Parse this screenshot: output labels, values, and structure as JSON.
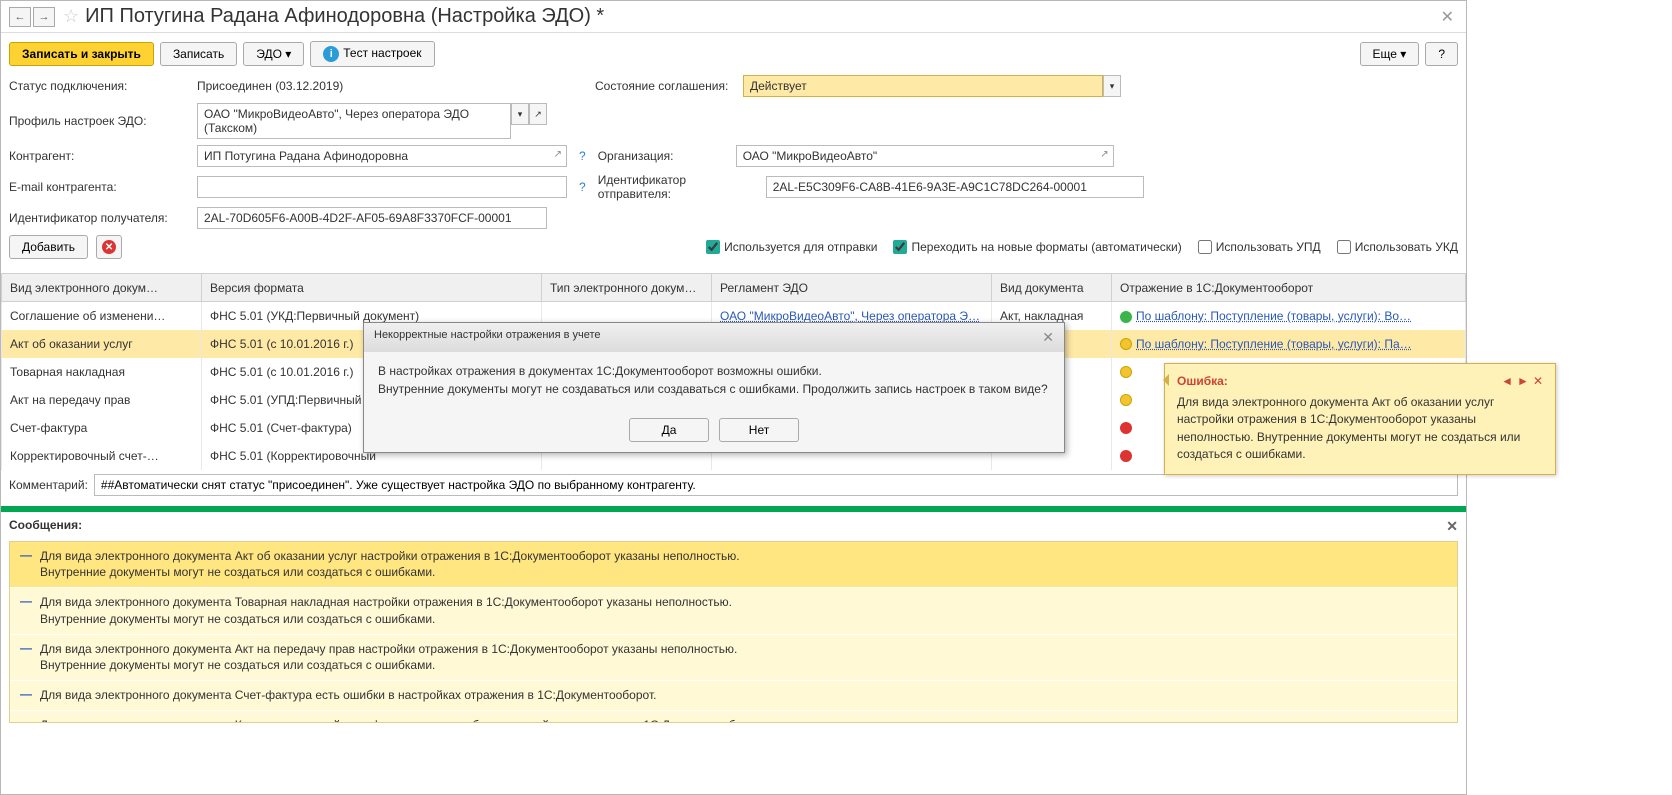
{
  "header": {
    "title": "ИП Потугина Радана Афинодоровна (Настройка ЭДО) *"
  },
  "toolbar": {
    "save_close": "Записать и закрыть",
    "save": "Записать",
    "edo": "ЭДО",
    "test": "Тест настроек",
    "more": "Еще",
    "help": "?"
  },
  "fields": {
    "status_label": "Статус подключения:",
    "status_value": "Присоединен (03.12.2019)",
    "agreement_label": "Состояние соглашения:",
    "agreement_value": "Действует",
    "profile_label": "Профиль настроек ЭДО:",
    "profile_value": "ОАО \"МикроВидеоАвто\", Через оператора ЭДО (Такском)",
    "counterparty_label": "Контрагент:",
    "counterparty_value": "ИП Потугина Радана Афинодоровна",
    "org_label": "Организация:",
    "org_value": "ОАО \"МикроВидеоАвто\"",
    "email_label": "E-mail контрагента:",
    "email_value": "",
    "sender_id_label": "Идентификатор отправителя:",
    "sender_id_value": "2AL-E5C309F6-CA8B-41E6-9A3E-A9C1C78DC264-00001",
    "recipient_id_label": "Идентификатор получателя:",
    "recipient_id_value": "2AL-70D605F6-A00B-4D2F-AF05-69A8F3370FCF-00001",
    "add": "Добавить",
    "chk_send": "Используется для отправки",
    "chk_auto": "Переходить на новые форматы (автоматически)",
    "chk_upd": "Использовать УПД",
    "chk_ukd": "Использовать УКД"
  },
  "table": {
    "cols": {
      "c0": "Вид электронного докум…",
      "c1": "Версия формата",
      "c2": "Тип электронного докум…",
      "c3": "Регламент ЭДО",
      "c4": "Вид документа",
      "c5": "Отражение в 1С:Документооборот"
    },
    "rows": [
      {
        "c0": "Соглашение об изменени…",
        "c1": "ФНС 5.01 (УКД:Первичный документ)",
        "c3": "ОАО \"МикроВидеоАвто\", Через оператора Э…",
        "c4": "Акт, накладная",
        "c5": "По шаблону: Поступление (товары, услуги): Во…",
        "dot": "g"
      },
      {
        "c0": "Акт об оказании услуг",
        "c1": "ФНС 5.01 (с 10.01.2016 г.)",
        "c3": "",
        "c4": "ная",
        "c5": "По шаблону: Поступление (товары, услуги): Па…",
        "dot": "y",
        "sel": true
      },
      {
        "c0": "Товарная накладная",
        "c1": "ФНС 5.01 (с 10.01.2016 г.)",
        "c3": "",
        "c4": "ная",
        "c5": "",
        "dot": "y"
      },
      {
        "c0": "Акт на передачу прав",
        "c1": "ФНС 5.01 (УПД:Первичный док",
        "c3": "",
        "c4": "ная",
        "c5": "",
        "dot": "y"
      },
      {
        "c0": "Счет-фактура",
        "c1": "ФНС 5.01 (Счет-фактура)",
        "c3": "",
        "c4": "ры",
        "c5": "",
        "dot": "r"
      },
      {
        "c0": "Корректировочный счет-…",
        "c1": "ФНС 5.01 (Корректировочный",
        "c3": "",
        "c4": "",
        "c5": "",
        "dot": "r"
      }
    ]
  },
  "comment": {
    "label": "Комментарий:",
    "value": "##Автоматически снят статус \"присоединен\". Уже существует настройка ЭДО по выбранному контрагенту."
  },
  "messages": {
    "label": "Сообщения:",
    "items": [
      "Для вида электронного документа Акт об оказании услуг настройки отражения в 1С:Документооборот указаны неполностью.\nВнутренние документы могут не создаться или создаться с ошибками.",
      "Для вида электронного документа Товарная накладная настройки отражения в 1С:Документооборот указаны неполностью.\nВнутренние документы могут не создаться или создаться с ошибками.",
      "Для вида электронного документа Акт на передачу прав настройки отражения в 1С:Документооборот указаны неполностью.\nВнутренние документы могут не создаться или создаться с ошибками.",
      "Для вида электронного документа Счет-фактура есть ошибки в настройках отражения в 1С:Документооборот.",
      "Для вида электронного документа Корректировочный счет-фактура есть ошибки в настройках отражения в 1С:Документооборот."
    ]
  },
  "modal": {
    "title": "Некорректные настройки отражения в учете",
    "line1": "В настройках отражения в документах 1С:Документооборот возможны ошибки.",
    "line2": "Внутренние документы могут не создаваться или создаваться с ошибками. Продолжить запись настроек в таком виде?",
    "yes": "Да",
    "no": "Нет"
  },
  "tooltip": {
    "title": "Ошибка:",
    "text": "Для вида электронного документа Акт об оказании услуг настройки отражения в 1С:Документооборот указаны неполностью. Внутренние документы могут не создаться или создаться с ошибками."
  }
}
